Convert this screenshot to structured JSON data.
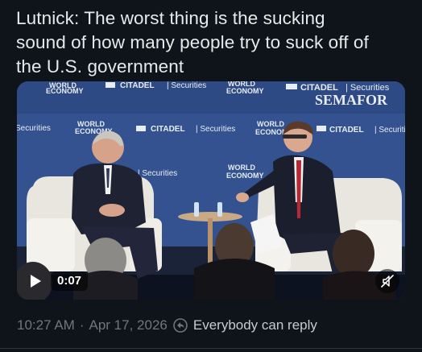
{
  "post": {
    "text_line1": "Lutnick: The worst thing is the sucking",
    "text_line2": "sound of how many people try to suck off of",
    "text_line3": "the U.S. government"
  },
  "video": {
    "duration": "0:07",
    "play_icon": "play-icon",
    "mute_icon": "muted-speaker-icon",
    "backdrop": {
      "world_economy_a": "WORLD",
      "world_economy_b": "ECONOMY",
      "semafor": "SEMAFOR",
      "citadel": "CITADEL",
      "securities": "Securities",
      "citadel_sep": "| Securities"
    }
  },
  "meta": {
    "time": "10:27 AM",
    "separator": "·",
    "date": "Apr 17, 2026",
    "reply_icon": "reply-permission-icon",
    "reply_setting": "Everybody can reply"
  },
  "colors": {
    "background": "#0f141a",
    "text": "#e7e9ea",
    "muted": "#71767b",
    "backdrop_blue": "#2f4d8c"
  }
}
